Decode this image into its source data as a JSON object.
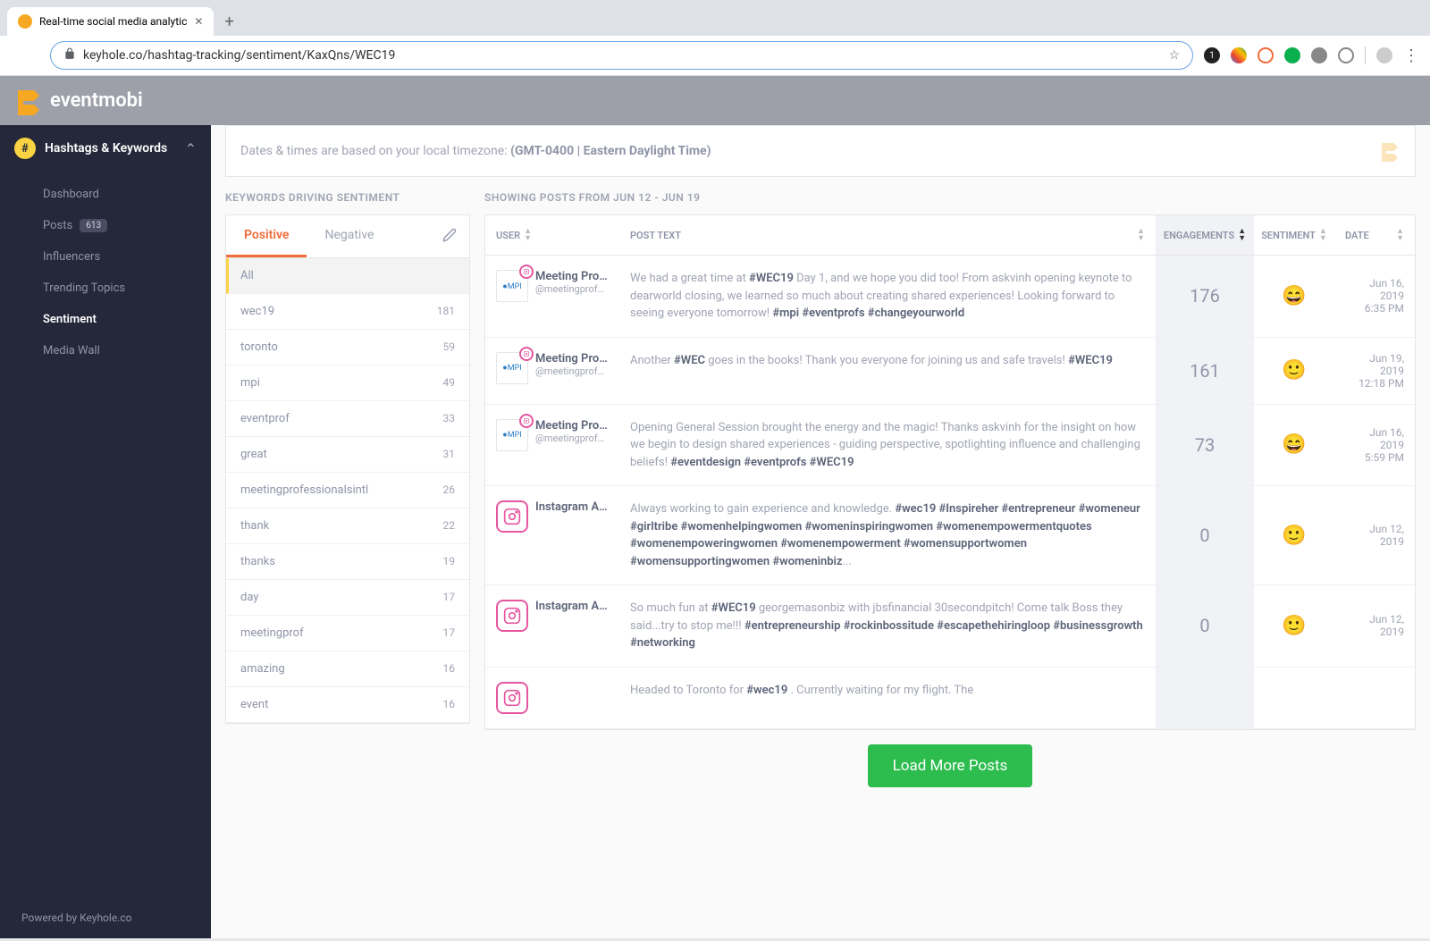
{
  "browser": {
    "tab_title": "Real-time social media analytic",
    "url": "keyhole.co/hashtag-tracking/sentiment/KaxQns/WEC19"
  },
  "header": {
    "brand": "eventmobi"
  },
  "sidebar": {
    "section_title": "Hashtags & Keywords",
    "items": [
      {
        "label": "Dashboard"
      },
      {
        "label": "Posts",
        "badge": "613"
      },
      {
        "label": "Influencers"
      },
      {
        "label": "Trending Topics"
      },
      {
        "label": "Sentiment",
        "active": true
      },
      {
        "label": "Media Wall"
      }
    ],
    "footer": "Powered by Keyhole.co"
  },
  "tz_banner": {
    "prefix": "Dates & times are based on your local timezone: ",
    "value": "(GMT-0400 | Eastern Daylight Time)"
  },
  "keywords_panel": {
    "title": "KEYWORDS DRIVING SENTIMENT",
    "tabs": {
      "positive": "Positive",
      "negative": "Negative"
    },
    "items": [
      {
        "label": "All",
        "count": "",
        "selected": true
      },
      {
        "label": "wec19",
        "count": "181"
      },
      {
        "label": "toronto",
        "count": "59"
      },
      {
        "label": "mpi",
        "count": "49"
      },
      {
        "label": "eventprof",
        "count": "33"
      },
      {
        "label": "great",
        "count": "31"
      },
      {
        "label": "meetingprofessionalsintl",
        "count": "26"
      },
      {
        "label": "thank",
        "count": "22"
      },
      {
        "label": "thanks",
        "count": "19"
      },
      {
        "label": "day",
        "count": "17"
      },
      {
        "label": "meetingprof",
        "count": "17"
      },
      {
        "label": "amazing",
        "count": "16"
      },
      {
        "label": "event",
        "count": "16"
      }
    ]
  },
  "posts_panel": {
    "title": "SHOWING POSTS FROM JUN 12 - JUN 19",
    "headers": {
      "user": "USER",
      "text": "POST TEXT",
      "engagements": "ENGAGEMENTS",
      "sentiment": "SENTIMENT",
      "date": "DATE"
    },
    "rows": [
      {
        "user_name": "Meeting Profe...",
        "user_handle": "@meetingprofessio...",
        "avatar_type": "mpi",
        "text_parts": [
          {
            "t": "We had a great time at ",
            "h": false
          },
          {
            "t": "#WEC19",
            "h": true
          },
          {
            "t": " Day 1, and we hope you did too! From askvinh opening keynote to dearworld closing, we learned so much about creating shared experiences! Looking forward to seeing everyone tomorrow! ",
            "h": false
          },
          {
            "t": "#mpi #eventprofs #changeyourworld",
            "h": true
          }
        ],
        "engagements": "176",
        "sentiment": "😄",
        "date": "Jun 16, 2019",
        "time": "6:35 PM"
      },
      {
        "user_name": "Meeting Profe...",
        "user_handle": "@meetingprofessio...",
        "avatar_type": "mpi",
        "text_parts": [
          {
            "t": "Another ",
            "h": false
          },
          {
            "t": "#WEC",
            "h": true
          },
          {
            "t": " goes in the books! Thank you everyone for joining us and safe travels! ",
            "h": false
          },
          {
            "t": "#WEC19",
            "h": true
          }
        ],
        "engagements": "161",
        "sentiment": "🙂",
        "date": "Jun 19, 2019",
        "time": "12:18 PM"
      },
      {
        "user_name": "Meeting Profe...",
        "user_handle": "@meetingprofessio...",
        "avatar_type": "mpi",
        "text_parts": [
          {
            "t": "Opening General Session brought the energy and the magic! Thanks askvinh for the insight on how we begin to design shared experiences - guiding perspective, spotlighting influence and challenging beliefs! ",
            "h": false
          },
          {
            "t": "#eventdesign #eventprofs #WEC19",
            "h": true
          }
        ],
        "engagements": "73",
        "sentiment": "😄",
        "date": "Jun 16, 2019",
        "time": "5:59 PM"
      },
      {
        "user_name": "Instagram Acc...",
        "user_handle": "",
        "avatar_type": "ig",
        "text_parts": [
          {
            "t": "Always working to gain experience and knowledge. ",
            "h": false
          },
          {
            "t": "#wec19 #Inspireher #entrepreneur #womeneur #girltribe #womenhelpingwomen #womeninspiringwomen #womenempowermentquotes #womenempoweringwomen #womenempowerment #womensupportwomen #womensupportingwomen #womeninbiz",
            "h": true
          },
          {
            "t": "...",
            "h": false
          }
        ],
        "engagements": "0",
        "sentiment": "🙂",
        "date": "Jun 12, 2019",
        "time": ""
      },
      {
        "user_name": "Instagram Acc...",
        "user_handle": "",
        "avatar_type": "ig",
        "text_parts": [
          {
            "t": "So much fun at ",
            "h": false
          },
          {
            "t": "#WEC19",
            "h": true
          },
          {
            "t": " georgemasonbiz with jbsfinancial 30secondpitch! Come talk Boss they said...try to stop me!!! ",
            "h": false
          },
          {
            "t": "#entrepreneurship #rockinbossitude #escapethehiringloop #businessgrowth #networking",
            "h": true
          }
        ],
        "engagements": "0",
        "sentiment": "🙂",
        "date": "Jun 12, 2019",
        "time": ""
      },
      {
        "user_name": "",
        "user_handle": "",
        "avatar_type": "ig",
        "text_parts": [
          {
            "t": "Headed to Toronto for ",
            "h": false
          },
          {
            "t": "#wec19",
            "h": true
          },
          {
            "t": " . Currently waiting for my flight. The",
            "h": false
          }
        ],
        "engagements": "",
        "sentiment": "",
        "date": "",
        "time": ""
      }
    ],
    "load_more": "Load More Posts"
  }
}
